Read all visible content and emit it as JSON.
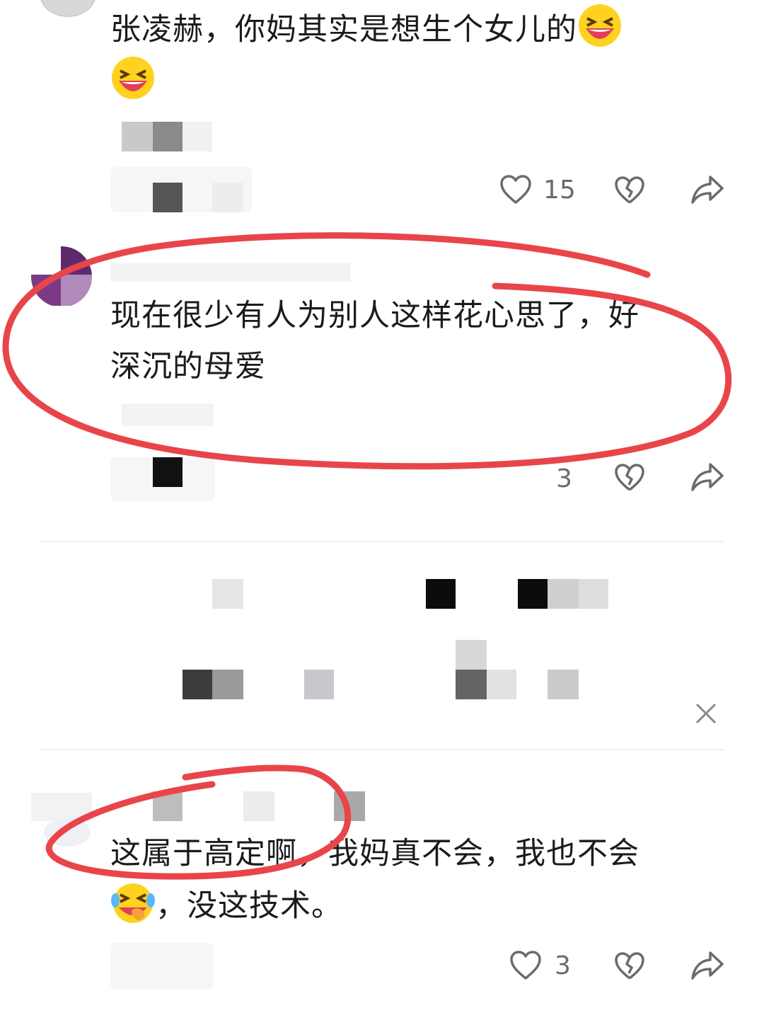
{
  "comments": [
    {
      "text_line1": "张凌赫，你妈其实是想生个女儿的",
      "emojis": [
        "laughing-emoji",
        "laughing-emoji"
      ],
      "like_count": "15"
    },
    {
      "text_line1": "现在很少有人为别人这样花心思了，好",
      "text_line2": "深沉的母爱",
      "like_count": "3"
    },
    {
      "text_line1": "这属于高定啊，我妈真不会，我也不会",
      "text_line2_suffix": "，没这技术。",
      "emoji": "crying-laughing-emoji",
      "like_count": "3"
    }
  ],
  "colors": {
    "annotation": "#e8454a",
    "text": "#1b1b1b",
    "icon": "#6b6b6b"
  },
  "icons": [
    "heart-icon",
    "broken-heart-icon",
    "share-icon",
    "close-icon"
  ]
}
